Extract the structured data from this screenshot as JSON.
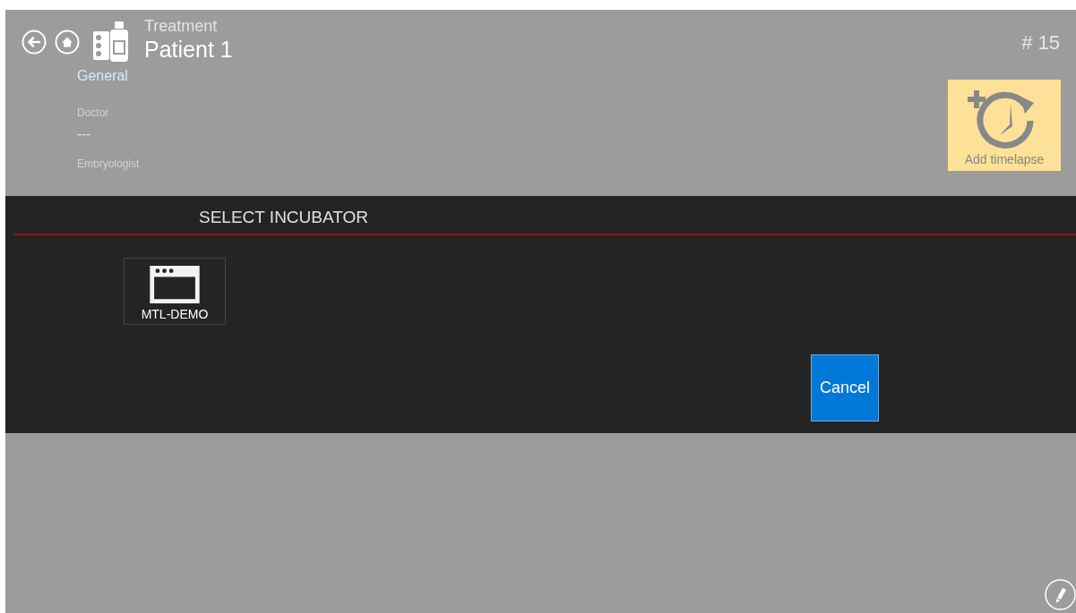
{
  "header": {
    "subtitle": "Treatment",
    "title": "Patient 1",
    "number": "# 15"
  },
  "section": {
    "title": "General",
    "fields": [
      {
        "label": "Doctor",
        "value": "---"
      },
      {
        "label": "Embryologist"
      }
    ]
  },
  "tile": {
    "label": "Add timelapse"
  },
  "dialog": {
    "title": "SELECT INCUBATOR",
    "incubators": [
      {
        "name": "MTL-DEMO",
        "selected": false
      }
    ],
    "cancel": "Cancel"
  }
}
